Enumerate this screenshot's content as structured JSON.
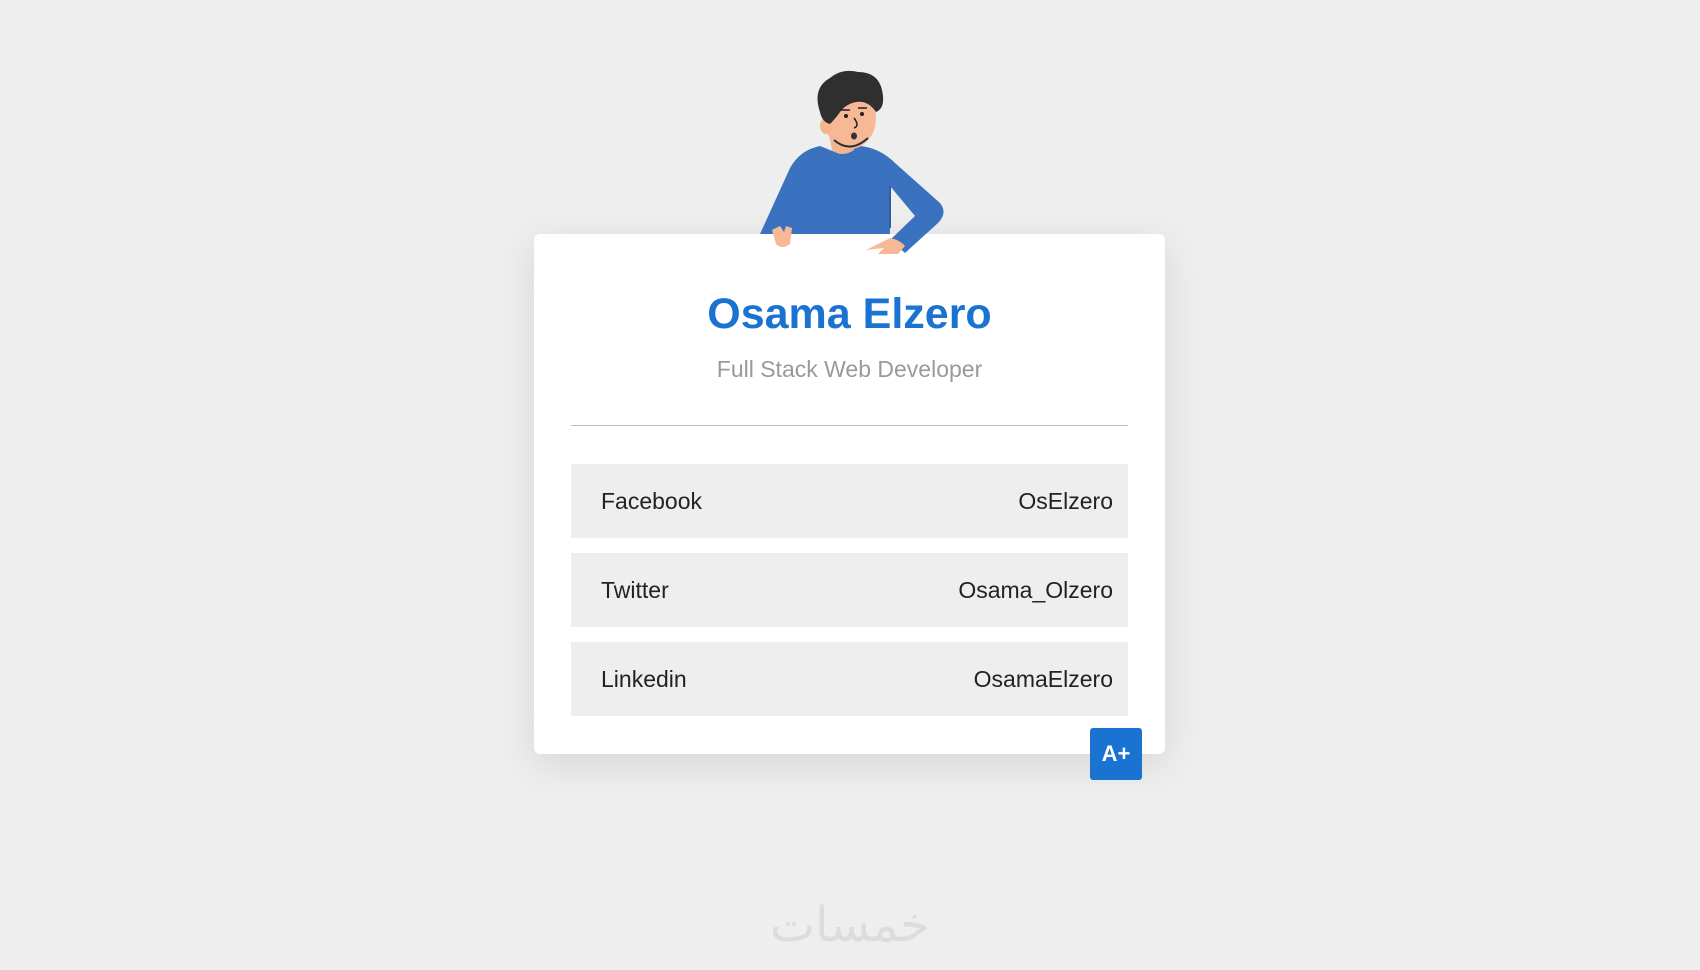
{
  "profile": {
    "name": "Osama Elzero",
    "title": "Full Stack Web Developer"
  },
  "links": [
    {
      "platform": "Facebook",
      "handle": "OsElzero"
    },
    {
      "platform": "Twitter",
      "handle": "Osama_Olzero"
    },
    {
      "platform": "Linkedin",
      "handle": "OsamaElzero"
    }
  ],
  "actions": {
    "add_label": "A+"
  },
  "watermark": "خمسات",
  "colors": {
    "accent": "#1a73d1",
    "background": "#eeeeee",
    "row_bg": "#eeeeee",
    "subtitle": "#9a9a9a"
  }
}
